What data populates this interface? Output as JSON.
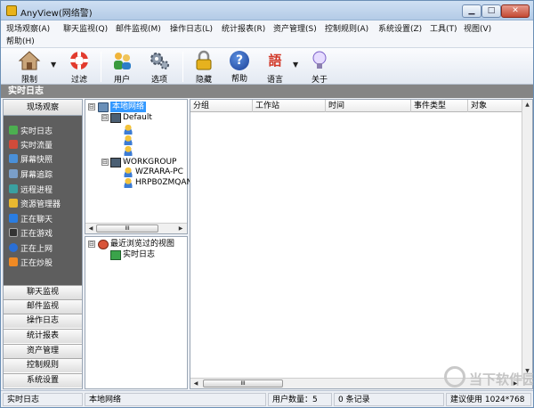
{
  "window": {
    "title": "AnyView(网络警)",
    "controls": {
      "minimize": "▁",
      "maximize": "□",
      "close": "✕"
    }
  },
  "menu": {
    "items": [
      "现场观察(A)",
      "聊天监视(Q)",
      "邮件监视(M)",
      "操作日志(L)",
      "统计报表(R)",
      "资产管理(S)",
      "控制规则(A)",
      "系统设置(Z)",
      "工具(T)",
      "视图(V)",
      "帮助(H)"
    ]
  },
  "toolbar": {
    "limit": "限制",
    "filter": "过滤",
    "users": "用户",
    "options": "选项",
    "hide": "隐藏",
    "help": "帮助",
    "language": "语言",
    "about": "关于",
    "dropdown_arrow": "▼",
    "language_icon_text": "語",
    "help_icon_text": "?"
  },
  "section": {
    "title": "实时日志"
  },
  "left": {
    "observe_header": "现场观察",
    "observe_items": [
      {
        "label": "实时日志",
        "icon": "log-icon",
        "color": "#4caf50"
      },
      {
        "label": "实时流量",
        "icon": "traffic-icon",
        "color": "#d04b3a"
      },
      {
        "label": "屏幕快照",
        "icon": "snapshot-icon",
        "color": "#4a90d9"
      },
      {
        "label": "屏幕追踪",
        "icon": "trace-icon",
        "color": "#7a9ec8"
      },
      {
        "label": "远程进程",
        "icon": "process-icon",
        "color": "#3aa0a0"
      },
      {
        "label": "资源管理器",
        "icon": "explorer-icon",
        "color": "#e8b830"
      },
      {
        "label": "正在聊天",
        "icon": "chat-icon",
        "color": "#2a7de1"
      },
      {
        "label": "正在游戏",
        "icon": "game-icon",
        "color": "#333333"
      },
      {
        "label": "正在上网",
        "icon": "web-icon",
        "color": "#2a6fd6"
      },
      {
        "label": "正在炒股",
        "icon": "stock-icon",
        "color": "#f08a24"
      }
    ],
    "scroll_down": "▼",
    "nav_buttons": [
      "聊天监视",
      "邮件监视",
      "操作日志",
      "统计报表",
      "资产管理",
      "控制规则",
      "系统设置"
    ]
  },
  "tree": {
    "root": "本地网络",
    "group1": "Default",
    "group2": "WORKGROUP",
    "pc1": "WZRARA-PC",
    "pc2": "HRPB0ZMQANS",
    "expand_symbol": "⊟",
    "scroll_thumb": "III",
    "scroll_left": "◀",
    "scroll_right": "▶"
  },
  "views": {
    "root": "最近浏览过的视图",
    "item": "实时日志"
  },
  "table": {
    "columns": [
      "分组",
      "工作站",
      "时间",
      "事件类型",
      "对象"
    ],
    "rows": [],
    "scroll_up": "▲",
    "scroll_down": "▼",
    "scroll_left": "◀",
    "scroll_right": "▶",
    "scroll_thumb": "III"
  },
  "status": {
    "section": "实时日志",
    "scope": "本地网络",
    "user_count": "用户数量：5",
    "records": "0 条记录",
    "resolution": "建议使用 1024*768"
  },
  "watermark": {
    "text": "当下软件园"
  }
}
